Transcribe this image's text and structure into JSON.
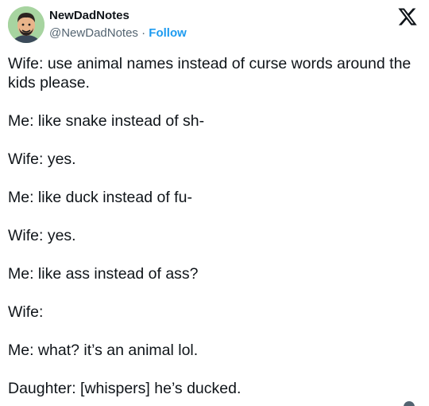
{
  "author": {
    "display_name": "NewDadNotes",
    "handle": "@NewDadNotes",
    "separator": "·",
    "follow_label": "Follow",
    "avatar_bg": "#a7d4a0"
  },
  "brand": {
    "logo_icon": "x-logo-icon"
  },
  "tweet": {
    "lines": [
      "Wife: use animal names instead of curse words around the kids please.",
      "Me: like snake instead of sh-",
      "Wife: yes.",
      "Me: like duck instead of fu-",
      "Wife: yes.",
      "Me: like ass instead of ass?",
      "Wife:",
      "Me: what? it’s an animal lol.",
      "Daughter: [whispers] he’s ducked."
    ]
  },
  "colors": {
    "text": "#0f1419",
    "secondary": "#536471",
    "accent": "#1d9bf0"
  }
}
